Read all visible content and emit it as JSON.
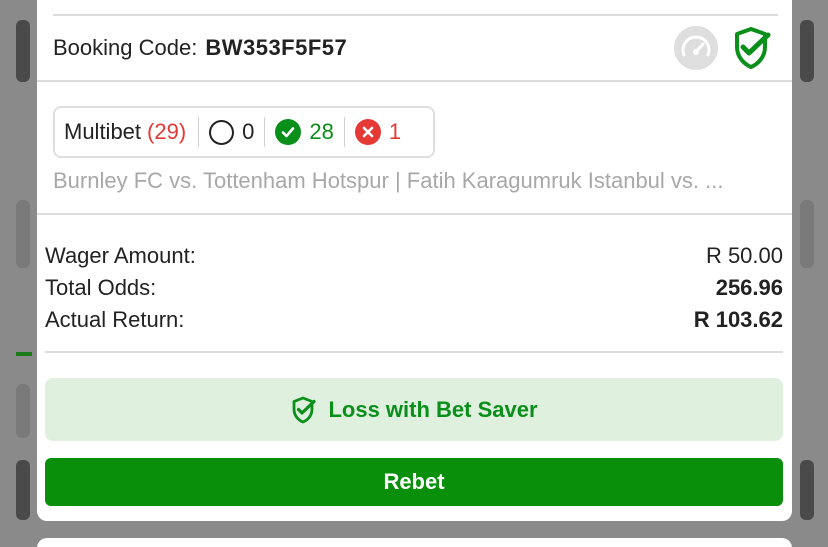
{
  "booking": {
    "label": "Booking Code:",
    "code": "BW353F5F57"
  },
  "multibet": {
    "label": "Multibet",
    "count": "(29)",
    "pending": "0",
    "won": "28",
    "lost": "1"
  },
  "matches_preview": "Burnley FC vs. Tottenham Hotspur | Fatih Karagumruk Istanbul vs. ...",
  "summary": {
    "wager_label": "Wager Amount:",
    "wager_value": "R 50.00",
    "odds_label": "Total Odds:",
    "odds_value": "256.96",
    "return_label": "Actual Return:",
    "return_value": "R 103.62"
  },
  "status_banner": "Loss with Bet Saver",
  "rebet_label": "Rebet",
  "colors": {
    "brand_green": "#0a8f0a",
    "loss_red": "#e53935",
    "banner_bg": "#dff0df"
  },
  "icons": {
    "speed": "speedometer-icon",
    "verified": "shield-check-icon"
  }
}
